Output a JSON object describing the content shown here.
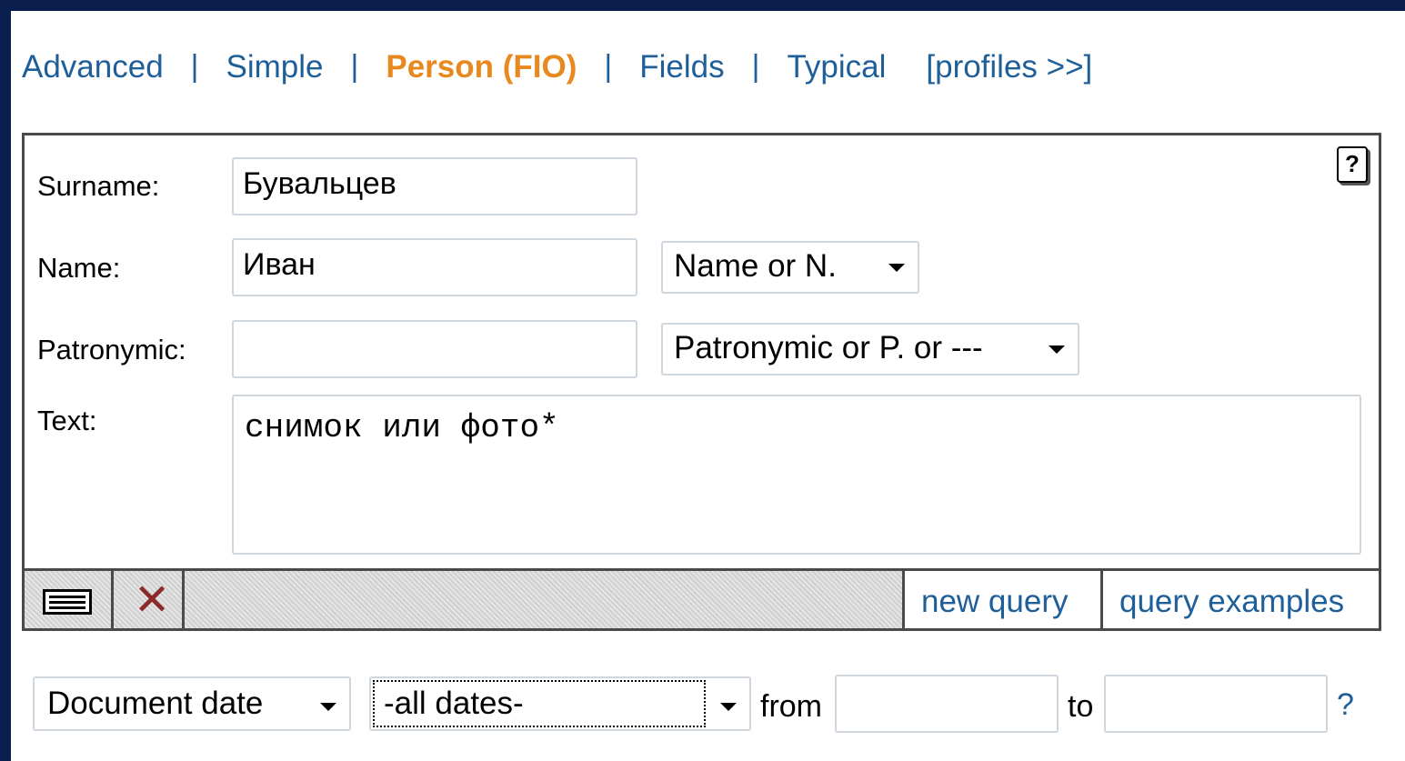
{
  "nav": {
    "tabs": [
      {
        "label": "Advanced"
      },
      {
        "label": "Simple"
      },
      {
        "label": "Person (FIO)",
        "active": true
      },
      {
        "label": "Fields"
      },
      {
        "label": "Typical"
      }
    ],
    "separator": "|",
    "profiles_label": "[profiles >>]"
  },
  "form": {
    "surname_label": "Surname:",
    "surname_value": "Бувальцев",
    "name_label": "Name:",
    "name_value": "Иван",
    "name_mode": "Name or N.",
    "patronymic_label": "Patronymic:",
    "patronymic_value": "",
    "patronymic_mode": "Patronymic or P. or ---",
    "text_label": "Text:",
    "text_value": "снимок или фото*",
    "help_icon": "?"
  },
  "toolbar": {
    "new_query": "new query",
    "query_examples": "query examples"
  },
  "dates": {
    "date_type": "Document date",
    "date_range": "-all dates-",
    "from_label": "from",
    "from_value": "",
    "to_label": "to",
    "to_value": "",
    "help": "?"
  },
  "colors": {
    "link": "#1f5f99",
    "active_tab": "#e8891f",
    "background": "#0b1f4f"
  }
}
